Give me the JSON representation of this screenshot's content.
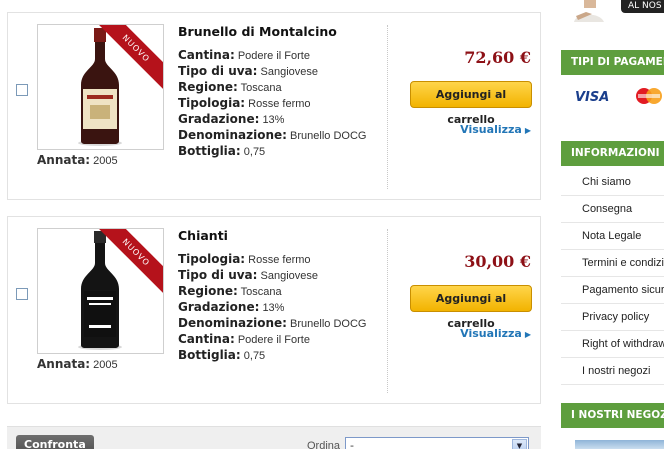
{
  "products": [
    {
      "name": "Brunello di Montalcino",
      "ribbon": "NUOVO",
      "attributes": [
        {
          "key": "Cantina:",
          "value": "Podere il Forte"
        },
        {
          "key": "Tipo di uva:",
          "value": "Sangiovese"
        },
        {
          "key": "Regione:",
          "value": "Toscana"
        },
        {
          "key": "Tipologia:",
          "value": "Rosse fermo"
        },
        {
          "key": "Gradazione:",
          "value": "13%"
        },
        {
          "key": "Denominazione:",
          "value": "Brunello DOCG"
        },
        {
          "key": "Bottiglia:",
          "value": "0,75"
        }
      ],
      "annata_label": "Annata:",
      "annata_value": "2005",
      "price": "72,60 €",
      "cart_button": "Aggiungi al carrello",
      "view_link": "Visualizza"
    },
    {
      "name": "Chianti",
      "ribbon": "NUOVO",
      "attributes": [
        {
          "key": "Tipologia:",
          "value": "Rosse fermo"
        },
        {
          "key": "Tipo di uva:",
          "value": "Sangiovese"
        },
        {
          "key": "Regione:",
          "value": "Toscana"
        },
        {
          "key": "Gradazione:",
          "value": "13%"
        },
        {
          "key": "Denominazione:",
          "value": "Brunello DOCG"
        },
        {
          "key": "Cantina:",
          "value": "Podere il Forte"
        },
        {
          "key": "Bottiglia:",
          "value": "0,75"
        }
      ],
      "annata_label": "Annata:",
      "annata_value": "2005",
      "price": "30,00 €",
      "cart_button": "Aggiungi al carrello",
      "view_link": "Visualizza"
    }
  ],
  "bottom_bar": {
    "compare_button": "Confronta",
    "sort_label": "Ordina",
    "sort_value": "-"
  },
  "sidebar": {
    "top_tab": "AL NOS",
    "payment_heading": "TIPI DI PAGAMENTO",
    "visa_label": "VISA",
    "info_heading": "INFORMAZIONI",
    "info_items": [
      "Chi siamo",
      "Consegna",
      "Nota Legale",
      "Termini e condizioni",
      "Pagamento sicuro",
      "Privacy policy",
      "Right of withdrawal",
      "I nostri negozi"
    ],
    "stores_heading": "I NOSTRI NEGOZI"
  },
  "colors": {
    "price": "#8d1016",
    "ribbon": "#b5121b",
    "cart_button": "#f2b300",
    "link": "#2276b7",
    "sidebar_heading": "#5e9e3e"
  }
}
